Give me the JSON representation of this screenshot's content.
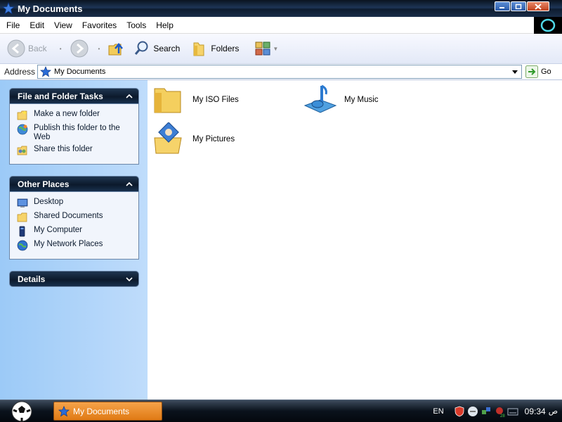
{
  "window": {
    "title": "My Documents",
    "icon": "star-documents-icon"
  },
  "menubar": {
    "items": [
      "File",
      "Edit",
      "View",
      "Favorites",
      "Tools",
      "Help"
    ]
  },
  "toolbar": {
    "back_label": "Back",
    "search_label": "Search",
    "folders_label": "Folders"
  },
  "address": {
    "label": "Address",
    "value": "My Documents",
    "go_label": "Go"
  },
  "taskpane": {
    "file_tasks": {
      "title": "File and Folder Tasks",
      "items": [
        {
          "label": "Make a new folder",
          "icon": "new-folder-icon"
        },
        {
          "label": "Publish this folder to the Web",
          "icon": "publish-web-icon"
        },
        {
          "label": "Share this folder",
          "icon": "share-folder-icon"
        }
      ]
    },
    "other_places": {
      "title": "Other Places",
      "items": [
        {
          "label": "Desktop",
          "icon": "desktop-icon"
        },
        {
          "label": "Shared Documents",
          "icon": "shared-documents-icon"
        },
        {
          "label": "My Computer",
          "icon": "my-computer-icon"
        },
        {
          "label": "My Network Places",
          "icon": "network-places-icon"
        }
      ]
    },
    "details": {
      "title": "Details"
    }
  },
  "content": {
    "items": [
      {
        "label": "My ISO Files",
        "icon": "folder-icon"
      },
      {
        "label": "My Music",
        "icon": "music-folder-icon"
      },
      {
        "label": "My Pictures",
        "icon": "pictures-folder-icon"
      }
    ]
  },
  "taskbar": {
    "active_window": "My Documents",
    "language": "EN",
    "time": "09:34",
    "ampm": "ص"
  },
  "colors": {
    "accent": "#e07a14",
    "taskpane": "#9ccaf7",
    "titlebar": "#0e1c30"
  }
}
